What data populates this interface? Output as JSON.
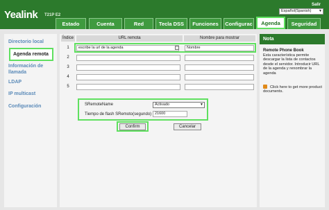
{
  "header": {
    "logo": "Yealink",
    "model": "T21P E2",
    "logout": "Salir",
    "language": "Español(Spanish)"
  },
  "tabs": [
    "Estado",
    "Cuenta",
    "Red",
    "Tecla DSS",
    "Funciones",
    "Configurac",
    "Agenda",
    "Seguridad"
  ],
  "active_tab": "Agenda",
  "sidebar": {
    "items": [
      "Directorio local",
      "Agenda remota",
      "Información de llamada",
      "LDAP",
      "IP multicast",
      "Configuración"
    ],
    "active": "Agenda remota"
  },
  "table": {
    "headers": {
      "index": "Índice",
      "url": "URL remota",
      "name": "Nombre para mostrar"
    },
    "rows": [
      {
        "index": "1",
        "url": "escribe la url de la agenda",
        "name": "Nombre"
      },
      {
        "index": "2",
        "url": "",
        "name": ""
      },
      {
        "index": "3",
        "url": "",
        "name": ""
      },
      {
        "index": "4",
        "url": "",
        "name": ""
      },
      {
        "index": "5",
        "url": "",
        "name": ""
      }
    ]
  },
  "settings": {
    "sremote_label": "SRemoteName",
    "sremote_value": "Activado",
    "flash_label": "Tiempo de flash SRemoto(segundo)",
    "flash_value": "21600"
  },
  "buttons": {
    "confirm": "Confirm",
    "cancel": "Cancelar"
  },
  "note": {
    "heading": "Nota",
    "title": "Remote Phone Book",
    "body": "Esta característica permite descargar la lista de contactos desde el servidor. Introducir URL de la agenda y renombrar la agenda",
    "link": "Click here to get more product documents."
  },
  "colors": {
    "header_green": "#2c7a2c",
    "tab_green": "#3f9a3f",
    "highlight": "#5fe05f",
    "link_blue": "#5a8ab8"
  }
}
